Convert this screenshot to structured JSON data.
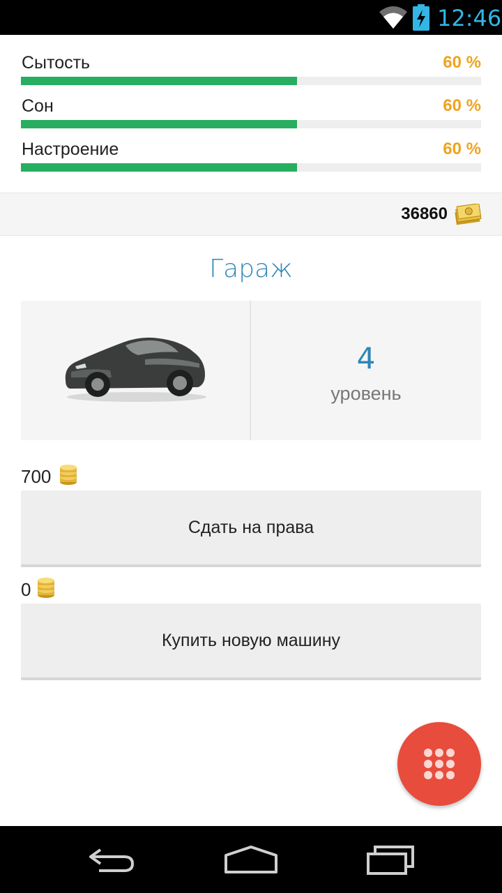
{
  "status_bar": {
    "time": "12:46",
    "icons": [
      "wifi-icon",
      "battery-charging-icon"
    ],
    "accent_color": "#33b5e5"
  },
  "stats": [
    {
      "label": "Сытость",
      "value": "60 %",
      "progress": 0.6
    },
    {
      "label": "Сон",
      "value": "60 %",
      "progress": 0.6
    },
    {
      "label": "Настроение",
      "value": "60 %",
      "progress": 0.6
    }
  ],
  "colors": {
    "progress_fill": "#27ae60",
    "progress_track": "#eeeeee",
    "stat_value": "#f0a31f",
    "title": "#2f86b5",
    "fab": "#e74c3c"
  },
  "money": {
    "amount": "36860",
    "icon": "cash-icon"
  },
  "garage": {
    "title": "Гараж",
    "image": "car-image",
    "level_value": "4",
    "level_label": "уровень"
  },
  "actions": [
    {
      "cost": "700",
      "cost_icon": "coins-icon",
      "label": "Сдать на права"
    },
    {
      "cost": "0",
      "cost_icon": "coins-icon",
      "label": "Купить новую машину"
    }
  ],
  "fab": {
    "icon": "grid-menu-icon"
  },
  "nav_bar": {
    "buttons": [
      "back-icon",
      "home-icon",
      "recents-icon"
    ]
  }
}
